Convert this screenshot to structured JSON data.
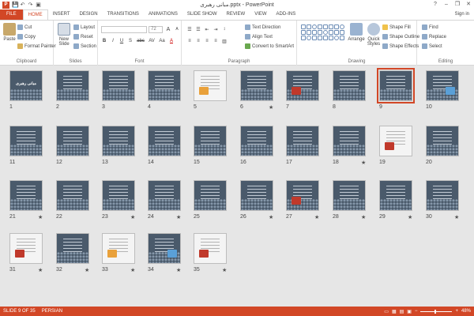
{
  "window": {
    "title": "مبانی رهبری.pptx - PowerPoint",
    "minimize": "–",
    "restore": "❐",
    "close": "✕",
    "help": "?"
  },
  "quick_access": {
    "logo": "P",
    "save": "💾",
    "undo": "↶",
    "redo": "↷",
    "present": "▣"
  },
  "tabs": [
    "FILE",
    "HOME",
    "INSERT",
    "DESIGN",
    "TRANSITIONS",
    "ANIMATIONS",
    "SLIDE SHOW",
    "REVIEW",
    "VIEW",
    "ADD-INS"
  ],
  "active_tab": "HOME",
  "signin": "Sign in",
  "ribbon": {
    "clipboard": {
      "label": "Clipboard",
      "paste": "Paste",
      "cut": "Cut",
      "copy": "Copy",
      "format_painter": "Format Painter"
    },
    "slides": {
      "label": "Slides",
      "new_slide": "New Slide",
      "layout": "Layout",
      "reset": "Reset",
      "section": "Section"
    },
    "font": {
      "label": "Font",
      "font_name": "",
      "font_size": "72",
      "bold": "B",
      "italic": "I",
      "underline": "U",
      "shadow": "S",
      "strike": "abc",
      "spacing": "AV",
      "case": "Aa",
      "grow": "A",
      "shrink": "A",
      "clear": "A"
    },
    "paragraph": {
      "label": "Paragraph",
      "text_direction": "Text Direction",
      "align_text": "Align Text",
      "convert_smartart": "Convert to SmartArt"
    },
    "drawing": {
      "label": "Drawing",
      "arrange": "Arrange",
      "quick_styles": "Quick Styles",
      "shape_fill": "Shape Fill",
      "shape_outline": "Shape Outline",
      "shape_effects": "Shape Effects"
    },
    "editing": {
      "label": "Editing",
      "find": "Find",
      "replace": "Replace",
      "select": "Select"
    }
  },
  "slides": [
    {
      "num": "1",
      "star": false,
      "type": "title",
      "title": "مبانی رهبری"
    },
    {
      "num": "2",
      "star": false,
      "type": "text"
    },
    {
      "num": "3",
      "star": false,
      "type": "text"
    },
    {
      "num": "4",
      "star": false,
      "type": "text"
    },
    {
      "num": "5",
      "star": false,
      "type": "light"
    },
    {
      "num": "6",
      "star": true,
      "type": "text"
    },
    {
      "num": "7",
      "star": false,
      "type": "pic"
    },
    {
      "num": "8",
      "star": false,
      "type": "text"
    },
    {
      "num": "9",
      "star": false,
      "type": "text",
      "selected": true
    },
    {
      "num": "10",
      "star": false,
      "type": "pic"
    },
    {
      "num": "11",
      "star": false,
      "type": "text"
    },
    {
      "num": "12",
      "star": false,
      "type": "text"
    },
    {
      "num": "13",
      "star": false,
      "type": "text"
    },
    {
      "num": "14",
      "star": false,
      "type": "text"
    },
    {
      "num": "15",
      "star": false,
      "type": "text"
    },
    {
      "num": "16",
      "star": false,
      "type": "text"
    },
    {
      "num": "17",
      "star": false,
      "type": "text"
    },
    {
      "num": "18",
      "star": true,
      "type": "text"
    },
    {
      "num": "19",
      "star": false,
      "type": "light"
    },
    {
      "num": "20",
      "star": false,
      "type": "text"
    },
    {
      "num": "21",
      "star": true,
      "type": "text"
    },
    {
      "num": "22",
      "star": false,
      "type": "text"
    },
    {
      "num": "23",
      "star": true,
      "type": "text"
    },
    {
      "num": "24",
      "star": true,
      "type": "text"
    },
    {
      "num": "25",
      "star": false,
      "type": "text"
    },
    {
      "num": "26",
      "star": true,
      "type": "text"
    },
    {
      "num": "27",
      "star": true,
      "type": "pic"
    },
    {
      "num": "28",
      "star": true,
      "type": "text"
    },
    {
      "num": "29",
      "star": true,
      "type": "text"
    },
    {
      "num": "30",
      "star": true,
      "type": "text"
    },
    {
      "num": "31",
      "star": true,
      "type": "light"
    },
    {
      "num": "32",
      "star": true,
      "type": "text"
    },
    {
      "num": "33",
      "star": true,
      "type": "light"
    },
    {
      "num": "34",
      "star": true,
      "type": "pic"
    },
    {
      "num": "35",
      "star": true,
      "type": "light"
    }
  ],
  "star_glyph": "★",
  "status": {
    "slide_of": "SLIDE 9 OF 35",
    "language": "PERSIAN",
    "zoom": "48%",
    "zoom_minus": "−",
    "zoom_plus": "+"
  },
  "colors": {
    "accent": "#d24726",
    "slide_bg": "#4a5a6b"
  }
}
